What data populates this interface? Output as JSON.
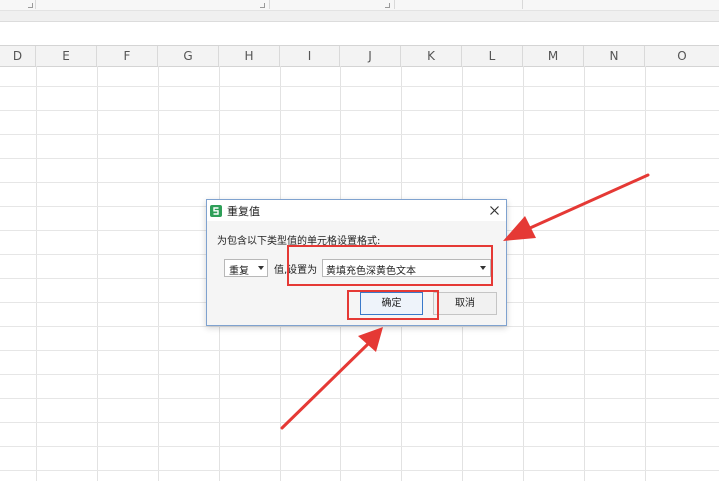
{
  "spreadsheet": {
    "columns": [
      "D",
      "E",
      "F",
      "G",
      "H",
      "I",
      "J",
      "K",
      "L",
      "M",
      "N",
      "O"
    ]
  },
  "dialog": {
    "title": "重复值",
    "prompt": "为包含以下类型值的单元格设置格式:",
    "value_type_selected": "重复",
    "middle_label": "值,设置为",
    "format_selected": "黄填充色深黄色文本",
    "ok_label": "确定",
    "cancel_label": "取消"
  },
  "colors": {
    "annotation": "#e53935",
    "dialog_border": "#7fa2cf",
    "ok_border": "#3a78c9",
    "app_icon": "#2e9f58"
  }
}
